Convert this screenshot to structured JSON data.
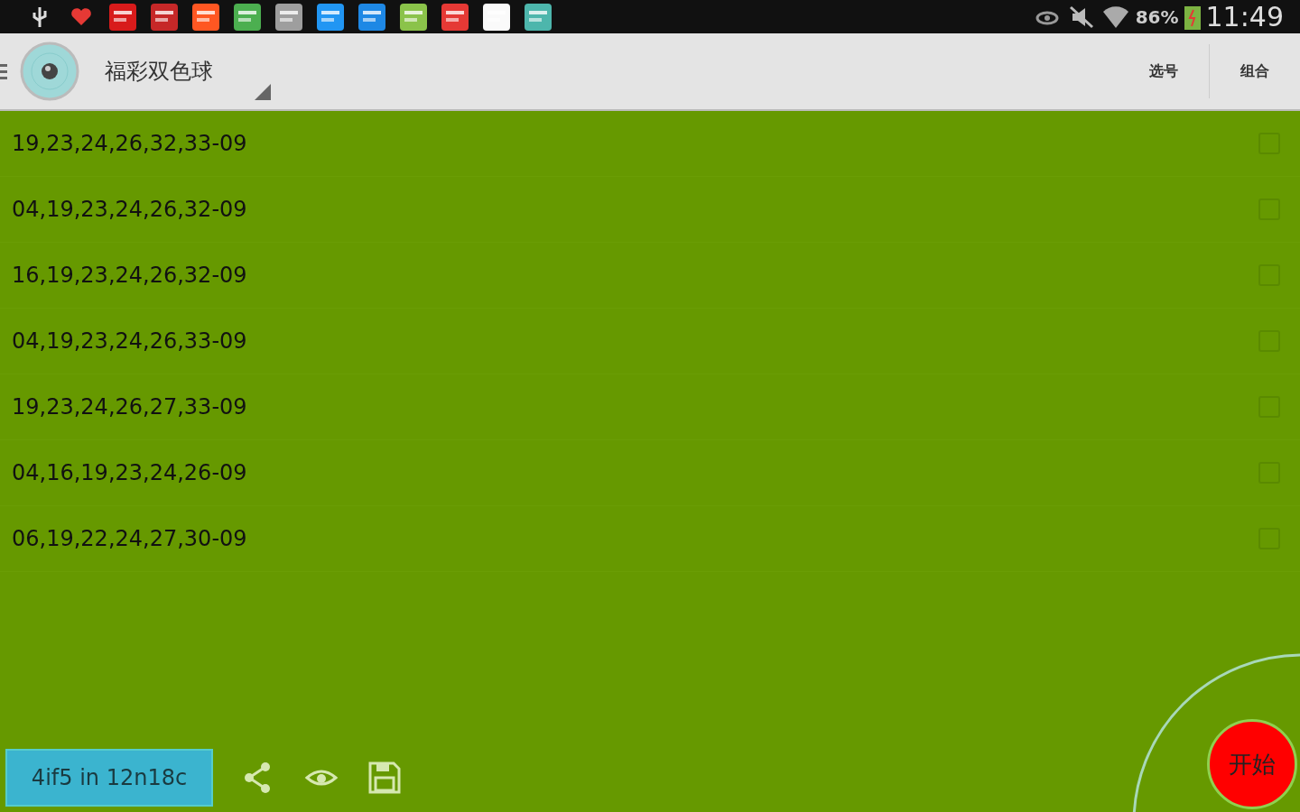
{
  "status_bar": {
    "battery": "86%",
    "time": "11:49"
  },
  "app_bar": {
    "title": "福彩双色球",
    "actions": [
      "选号",
      "组合"
    ]
  },
  "rows": [
    {
      "numbers": "19,23,24,26,32,33-09",
      "checked": false
    },
    {
      "numbers": "04,19,23,24,26,32-09",
      "checked": false
    },
    {
      "numbers": "16,19,23,24,26,32-09",
      "checked": false
    },
    {
      "numbers": "04,19,23,24,26,33-09",
      "checked": false
    },
    {
      "numbers": "19,23,24,26,27,33-09",
      "checked": false
    },
    {
      "numbers": "04,16,19,23,24,26-09",
      "checked": false
    },
    {
      "numbers": "06,19,22,24,27,30-09",
      "checked": false
    }
  ],
  "bottom_bar": {
    "summary_button": "4if5 in 12n18c",
    "start_button": "开始"
  }
}
